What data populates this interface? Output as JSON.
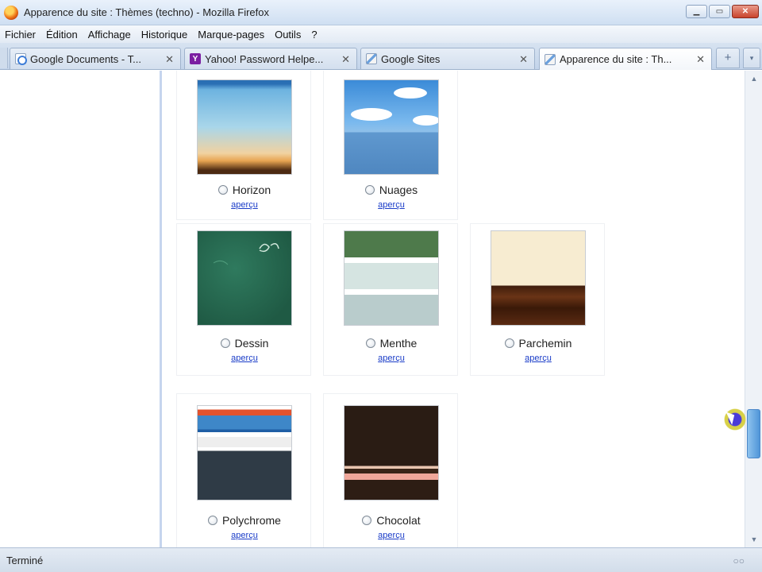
{
  "window": {
    "title": "Apparence du site : Thèmes (techno) - Mozilla Firefox"
  },
  "menu": [
    "Fichier",
    "Édition",
    "Affichage",
    "Historique",
    "Marque-pages",
    "Outils",
    "?"
  ],
  "tabs": [
    {
      "label": "Google Documents - T...",
      "icon": "google-docs-icon"
    },
    {
      "label": "Yahoo! Password Helpe...",
      "icon": "yahoo-icon"
    },
    {
      "label": "Google Sites",
      "icon": "google-sites-icon"
    },
    {
      "label": "Apparence du site : Th...",
      "icon": "google-sites-icon",
      "active": true
    }
  ],
  "themes": [
    {
      "name": "Horizon",
      "preview": "aperçu"
    },
    {
      "name": "Nuages",
      "preview": "aperçu"
    },
    {
      "name": "Dessin",
      "preview": "aperçu"
    },
    {
      "name": "Menthe",
      "preview": "aperçu"
    },
    {
      "name": "Parchemin",
      "preview": "aperçu"
    },
    {
      "name": "Polychrome",
      "preview": "aperçu"
    },
    {
      "name": "Chocolat",
      "preview": "aperçu"
    }
  ],
  "status": {
    "text": "Terminé"
  },
  "colors": {
    "link": "#1a3cc8",
    "accent": "#4f95d8"
  }
}
